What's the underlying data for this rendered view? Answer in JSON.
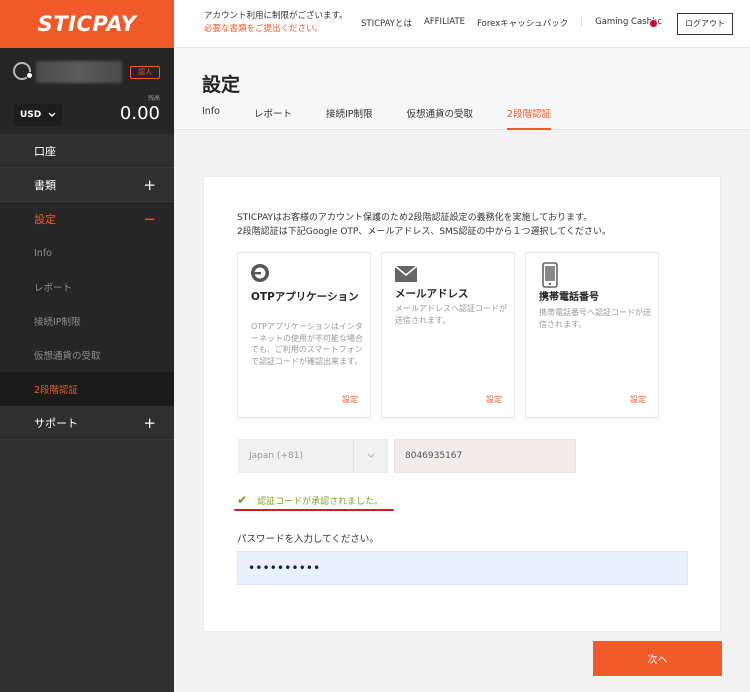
{
  "brand": {
    "logo": "STICPAY",
    "accent": "#f05a28"
  },
  "user": {
    "badge": "認人",
    "balance_label": "残高",
    "currency": "USD",
    "balance": "0.00"
  },
  "sidebar": {
    "items": [
      {
        "label": "口座"
      },
      {
        "label": "書類",
        "toggle": "+"
      },
      {
        "label": "設定",
        "toggle": "−"
      }
    ],
    "sub_items": [
      {
        "label": "Info"
      },
      {
        "label": "レポート"
      },
      {
        "label": "接続IP制限"
      },
      {
        "label": "仮想通貨の受取"
      },
      {
        "label": "2段階認証"
      }
    ],
    "support": {
      "label": "サポート",
      "toggle": "+"
    }
  },
  "header": {
    "notice_line1": "アカウント利用に制限がございます。",
    "notice_line2": "必要な書類をご提出ください。",
    "nav": [
      "STICPAYとは",
      "AFFILIATE",
      "Forexキャッシュバック",
      "Gaming Cashbc"
    ],
    "logout": "ログアウト"
  },
  "page": {
    "title": "設定",
    "tabs": [
      "Info",
      "レポート",
      "接続IP制限",
      "仮想通貨の受取",
      "2段階認証"
    ]
  },
  "content": {
    "desc_line1": "STICPAYはお客様のアカウント保護のため2段階認証設定の義務化を実施しております。",
    "desc_line2": "2段階認証は下記Google OTP、メールアドレス、SMS認証の中から１つ選択してください。",
    "options": [
      {
        "title": "OTPアプリケーション",
        "desc": "OTPアプリケーションはインターネットの使用が不可能な場合でも、ご利用のスマートフォンで認証コードが確認出来ます。",
        "action": "設定"
      },
      {
        "title": "メールアドレス",
        "desc": "メールアドレスへ認証コードが送信されます。",
        "action": "設定"
      },
      {
        "title": "携帯電話番号",
        "desc": "携帯電話番号へ認証コードが送信されます。",
        "action": "設定"
      }
    ],
    "country": "Japan (+81)",
    "phone": "8046935167",
    "verified_msg": "認証コードが承認されました。",
    "password_label": "パスワードを入力してください。",
    "password_value": "••••••••••",
    "next": "次へ"
  }
}
